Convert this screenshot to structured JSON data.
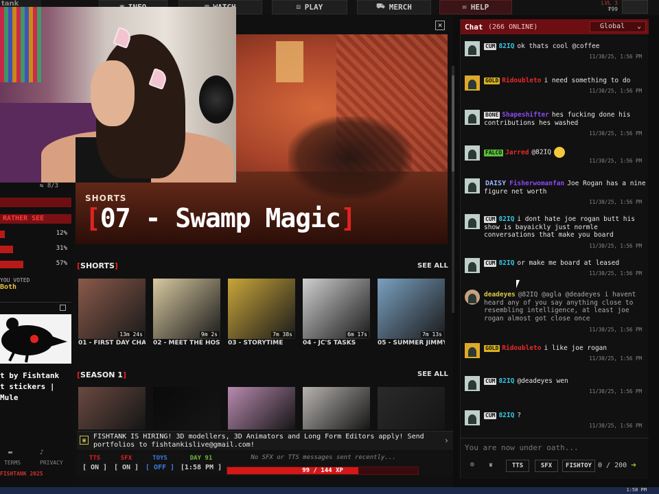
{
  "nav": {
    "logo": "tank",
    "buttons": [
      {
        "label": "INFO",
        "icon": "info-icon"
      },
      {
        "label": "WATCH",
        "icon": "tv-icon"
      },
      {
        "label": "PLAY",
        "icon": "dice-icon"
      },
      {
        "label": "MERCH",
        "icon": "cart-icon"
      },
      {
        "label": "HELP",
        "icon": "help-chat-icon"
      }
    ],
    "level": "LVL 3",
    "coins": "₮99"
  },
  "sidebar": {
    "count": "⇆ 8/3",
    "poll_title": "RATHER SEE",
    "poll": [
      {
        "pct": "12%",
        "value": 0.12
      },
      {
        "pct": "31%",
        "value": 0.31
      },
      {
        "pct": "57%",
        "value": 0.57
      }
    ],
    "voted_label": "YOU VOTED",
    "voted_choice": "Both",
    "promo_text": "t by Fishtank\nt stickers |\nMule",
    "footer_terms": "TERMS",
    "footer_privacy": "PRIVACY",
    "footer_copy": "FISHTANK 2025"
  },
  "hero": {
    "tag": "SHORTS",
    "title": "07 - Swamp Magic",
    "bracket_open": "[",
    "bracket_close": "]"
  },
  "shorts": {
    "heading": "SHORTS",
    "see_all": "SEE ALL",
    "items": [
      {
        "label": "01 - FIRST DAY CHA",
        "duration": "13m 24s",
        "color": "#8a5a4a"
      },
      {
        "label": "02 - MEET THE HOST",
        "duration": "9m 2s",
        "color": "#d8c9a0"
      },
      {
        "label": "03 - STORYTIME",
        "duration": "7m 38s",
        "color": "#c9a63a"
      },
      {
        "label": "04 - JC'S TASKS",
        "duration": "6m 17s",
        "color": "#cfcfcf"
      },
      {
        "label": "05 - SUMMER JIMMY V",
        "duration": "7m 13s",
        "color": "#7aa0c0"
      }
    ]
  },
  "season": {
    "heading": "SEASON 1",
    "see_all": "SEE ALL",
    "items": [
      {
        "color": "#6a4a40"
      },
      {
        "color": "#0a0a0a"
      },
      {
        "color": "#b88ab0"
      },
      {
        "color": "#b7b3b0"
      },
      {
        "color": "#2a2a2a"
      }
    ]
  },
  "ticker": {
    "text": "FISHTANK IS HIRING! 3D modellers, 3D Animators and Long Form Editors apply! Send portfolios to fishtankislive@gmail.com!"
  },
  "toggles": [
    {
      "label": "TTS",
      "value": "[ ON ]",
      "color": "#e0231f"
    },
    {
      "label": "SFX",
      "value": "[ ON ]",
      "color": "#e0231f"
    },
    {
      "label": "TOYS",
      "value": "[ OFF ]",
      "color": "#3d7bd9"
    },
    {
      "label": "DAY 91",
      "value": "[1:58 PM ]",
      "color": "#6dbb3a"
    }
  ],
  "status_message": "No SFX or TTS messages sent recently...",
  "xp": {
    "text": "99 / 144 XP",
    "value": 0.6875
  },
  "chat": {
    "title": "Chat",
    "online": "(266 ONLINE)",
    "channel": "Global",
    "messages": [
      {
        "badge": "CUM",
        "badge_class": "b-cum",
        "user": "82IQ",
        "user_class": "u-82iq",
        "text": "ok thats cool @coffee",
        "ts": "11/30/25, 1:56 PM"
      },
      {
        "badge": "GOLD",
        "badge_class": "b-gold",
        "user": "Ridoubleto",
        "user_class": "u-red",
        "text": "i need something to do",
        "ts": "11/30/25, 1:56 PM"
      },
      {
        "badge": "BONE",
        "badge_class": "b-bone",
        "user": "Shapeshifter",
        "user_class": "u-purple",
        "text": "hes fucking done his contributions hes washed",
        "ts": "11/30/25, 1:56 PM"
      },
      {
        "badge": "FALCO",
        "badge_class": "b-falco",
        "user": "Jarred",
        "user_class": "u-red",
        "text": "@82IQ",
        "ts": "11/30/25, 1:56 PM",
        "emoji": true
      },
      {
        "badge": "DAISY",
        "badge_class": "",
        "user": "Fisherwomanfan",
        "user_class": "u-purple",
        "text": "Joe Rogan has a nine figure net worth",
        "ts": "11/30/25, 1:56 PM",
        "daisy": true
      },
      {
        "badge": "CUM",
        "badge_class": "b-cum",
        "user": "82IQ",
        "user_class": "u-82iq",
        "text": "i dont hate joe rogan butt his show is bayaickly just normle conversations that make you board",
        "ts": "11/30/25, 1:56 PM"
      },
      {
        "badge": "CUM",
        "badge_class": "b-cum",
        "user": "82IQ",
        "user_class": "u-82iq",
        "text": "or make me board at leased",
        "ts": "11/30/25, 1:56 PM"
      },
      {
        "badge": "",
        "badge_class": "",
        "user": "deadeyes",
        "user_class": "u-dead",
        "text": "@82IQ @agla @deadeyes i havent heard any of you say anything close to resembling intelligence, at least joe rogan almost got close once",
        "ts": "11/30/25, 1:56 PM"
      },
      {
        "badge": "GOLD",
        "badge_class": "b-gold",
        "user": "Ridoubleto",
        "user_class": "u-red",
        "text": "i like joe rogan",
        "ts": "11/30/25, 1:56 PM"
      },
      {
        "badge": "CUM",
        "badge_class": "b-cum",
        "user": "82IQ",
        "user_class": "u-82iq",
        "text": "@deadeyes wen",
        "ts": "11/30/25, 1:56 PM"
      },
      {
        "badge": "CUM",
        "badge_class": "b-cum",
        "user": "82IQ",
        "user_class": "u-82iq",
        "text": "?",
        "ts": "11/30/25, 1:56 PM"
      }
    ],
    "input_placeholder": "You are now under oath...",
    "tools": [
      "TTS",
      "SFX",
      "FISHTOY"
    ],
    "char_count": "0 / 200"
  },
  "taskbar": {
    "clock": "1:58 PM"
  }
}
